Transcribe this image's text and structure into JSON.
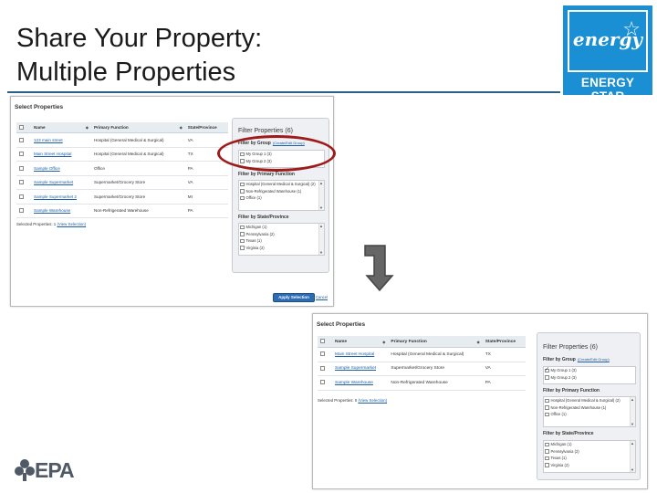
{
  "slide": {
    "title_line1": "Share Your Property:",
    "title_line2": "Multiple Properties"
  },
  "logos": {
    "energy_star_script": "energy",
    "energy_star_word": "ENERGY STAR",
    "epa": "EPA",
    "colors": {
      "energy_star_blue": "#1b8fd4",
      "epa_gray": "#4f5a66"
    }
  },
  "screen1": {
    "panel_title": "Select Properties",
    "columns": [
      "Name",
      "Primary Function",
      "State/Province"
    ],
    "rows": [
      {
        "name": "123 main street",
        "function": "Hospital (General Medical & Surgical)",
        "state": "VA"
      },
      {
        "name": "Main Street Hospital",
        "function": "Hospital (General Medical & Surgical)",
        "state": "TX"
      },
      {
        "name": "Sample Office",
        "function": "Office",
        "state": "PA"
      },
      {
        "name": "Sample Supermarket",
        "function": "Supermarket/Grocery Store",
        "state": "VA"
      },
      {
        "name": "Sample Supermarket 2",
        "function": "Supermarket/Grocery Store",
        "state": "MI"
      },
      {
        "name": "Sample Warehouse",
        "function": "Non-Refrigerated Warehouse",
        "state": "PA"
      }
    ],
    "selected_label": "Selected Properties: 1",
    "view_selection": "(View Selection)",
    "filter": {
      "title": "Filter Properties",
      "count": "(6)",
      "group_header": "Filter by Group",
      "edit_groups": "(Create/Edit Group)",
      "groups": [
        "My Group 1 (3)",
        "My Group 2 (3)"
      ],
      "function_header": "Filter by Primary Function",
      "functions": [
        "Hospital (General Medical & Surgical) (2)",
        "Non-Refrigerated Warehouse (1)",
        "Office (1)"
      ],
      "state_header": "Filter by State/Province",
      "states": [
        "Michigan (1)",
        "Pennsylvania (2)",
        "Texas (1)",
        "Virginia (2)"
      ]
    },
    "apply_button": "Apply Selection",
    "cancel": "Cancel"
  },
  "screen2": {
    "panel_title": "Select Properties",
    "columns": [
      "Name",
      "Primary Function",
      "State/Province"
    ],
    "rows": [
      {
        "name": "Main Street Hospital",
        "function": "Hospital (General Medical & Surgical)",
        "state": "TX"
      },
      {
        "name": "Sample Supermarket",
        "function": "Supermarket/Grocery Store",
        "state": "VA"
      },
      {
        "name": "Sample Warehouse",
        "function": "Non-Refrigerated Warehouse",
        "state": "PA"
      }
    ],
    "selected_label": "Selected Properties: 0",
    "view_selection": "(View Selection)",
    "filter": {
      "title": "Filter Properties",
      "count": "(6)",
      "group_header": "Filter by Group",
      "edit_groups": "(Create/Edit Group)",
      "groups": [
        "My Group 1 (3)",
        "My Group 2 (3)"
      ],
      "groups_checked": [
        true,
        false
      ],
      "function_header": "Filter by Primary Function",
      "functions": [
        "Hospital (General Medical & Surgical) (2)",
        "Non-Refrigerated Warehouse (1)",
        "Office (1)"
      ],
      "state_header": "Filter by State/Province",
      "states": [
        "Michigan (1)",
        "Pennsylvania (2)",
        "Texas (1)",
        "Virginia (2)"
      ]
    }
  }
}
